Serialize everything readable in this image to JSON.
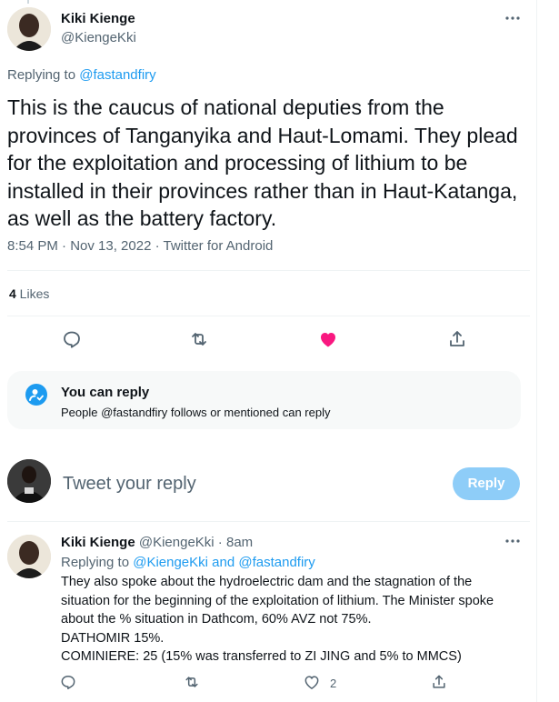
{
  "tweet": {
    "author_name": "Kiki Kienge",
    "author_handle": "@KiengeKki",
    "replying_prefix": "Replying to ",
    "replying_to": "@fastandfiry",
    "text": "This is the caucus of national deputies from the provinces of Tanganyika and Haut-Lomami. They plead for the exploitation and processing of lithium to be installed in their provinces rather than in Haut-Katanga, as well as the battery factory.",
    "timestamp": "8:54 PM · Nov 13, 2022 · Twitter for Android",
    "likes_count": "4",
    "likes_label": " Likes"
  },
  "reply_permission": {
    "title": "You can reply",
    "subtitle": "People @fastandfiry follows or mentioned can reply"
  },
  "composer": {
    "placeholder": "Tweet your reply",
    "button_label": "Reply"
  },
  "reply": {
    "author_name": "Kiki Kienge",
    "author_handle": "@KiengeKki",
    "dot": " · ",
    "time": "8am",
    "replying_prefix": "Replying to ",
    "replying_to": "@KiengeKki and @fastandfiry",
    "lines": [
      "They also spoke about the hydroelectric dam and the stagnation of the",
      "situation for the beginning of the exploitation of lithium. The Minister spoke",
      "about the % situation in Dathcom, 60% AVZ not 75%.",
      "DATHOMIR 15%.",
      "COMINIERE: 25 (15% was transferred to ZI JING and 5% to MMCS)"
    ],
    "like_count": "2"
  },
  "colors": {
    "accent": "#1d9bf0",
    "like_active": "#f91880",
    "muted": "#536471"
  },
  "icons": [
    "more-icon",
    "reply-icon",
    "retweet-icon",
    "heart-icon",
    "share-icon",
    "person-check-icon"
  ]
}
